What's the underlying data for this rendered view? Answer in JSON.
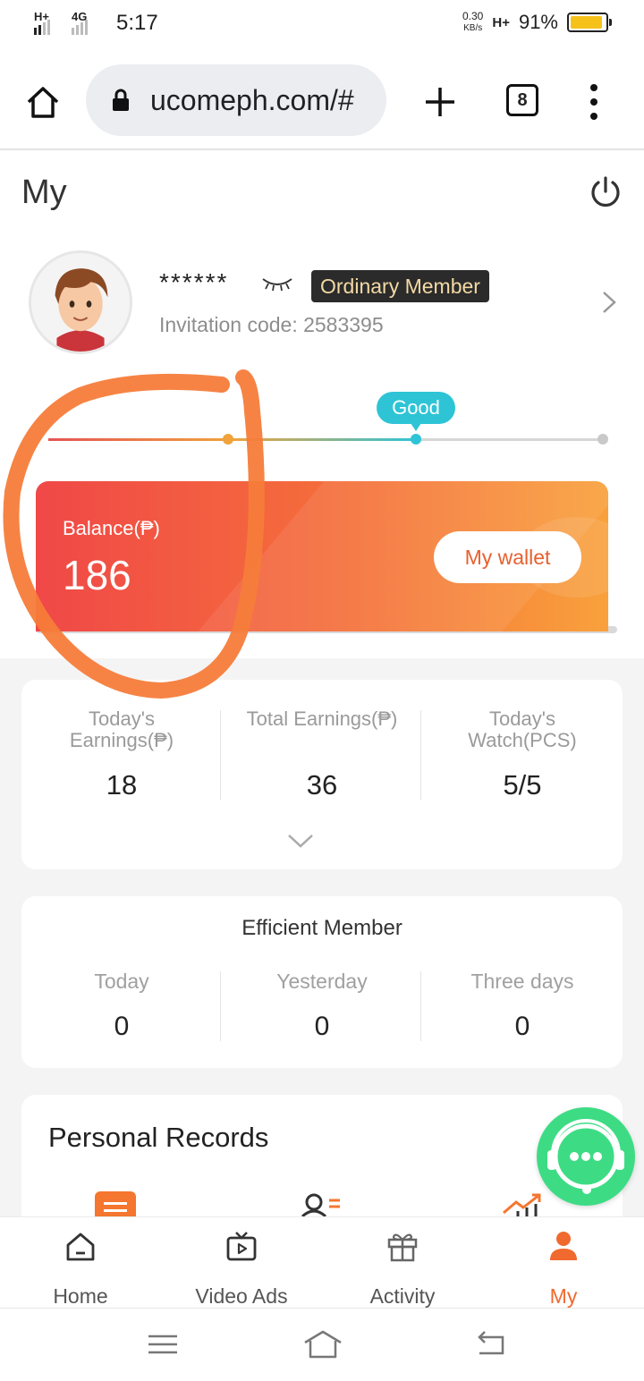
{
  "status_bar": {
    "network_1": "H+",
    "network_2": "4G",
    "time": "5:17",
    "speed_value": "0.30",
    "speed_unit": "KB/s",
    "network_3": "H+",
    "battery_percent": "91%",
    "battery_level": 0.91,
    "battery_color": "#f6c21a"
  },
  "browser": {
    "url": "ucomeph.com/#",
    "tab_count": "8"
  },
  "page": {
    "title": "My"
  },
  "profile": {
    "masked_name": "******",
    "badge": "Ordinary Member",
    "invitation_code": "Invitation code: 2583395"
  },
  "level": {
    "current_label": "Good",
    "progress": 0.66
  },
  "balance": {
    "label": "Balance(₱)",
    "value": "186",
    "wallet_button": "My wallet"
  },
  "stats": [
    {
      "label_1": "Today's",
      "label_2": "Earnings(₱)",
      "value": "18"
    },
    {
      "label_1": "Total Earnings(₱)",
      "label_2": "",
      "value": "36"
    },
    {
      "label_1": "Today's",
      "label_2": "Watch(PCS)",
      "value": "5/5"
    }
  ],
  "efficient_member": {
    "title": "Efficient Member",
    "columns": [
      {
        "label": "Today",
        "value": "0"
      },
      {
        "label": "Yesterday",
        "value": "0"
      },
      {
        "label": "Three days",
        "value": "0"
      }
    ]
  },
  "records": {
    "title": "Personal Records"
  },
  "bottom_nav": [
    {
      "label": "Home",
      "icon": "home-icon"
    },
    {
      "label": "Video Ads",
      "icon": "video-ads-icon"
    },
    {
      "label": "Activity",
      "icon": "gift-icon"
    },
    {
      "label": "My",
      "icon": "user-icon",
      "active": true
    }
  ],
  "colors": {
    "accent": "#f0692e",
    "level_teal": "#2ec4d6",
    "chat_green": "#3ddc84",
    "annotation": "#f57c3a"
  }
}
